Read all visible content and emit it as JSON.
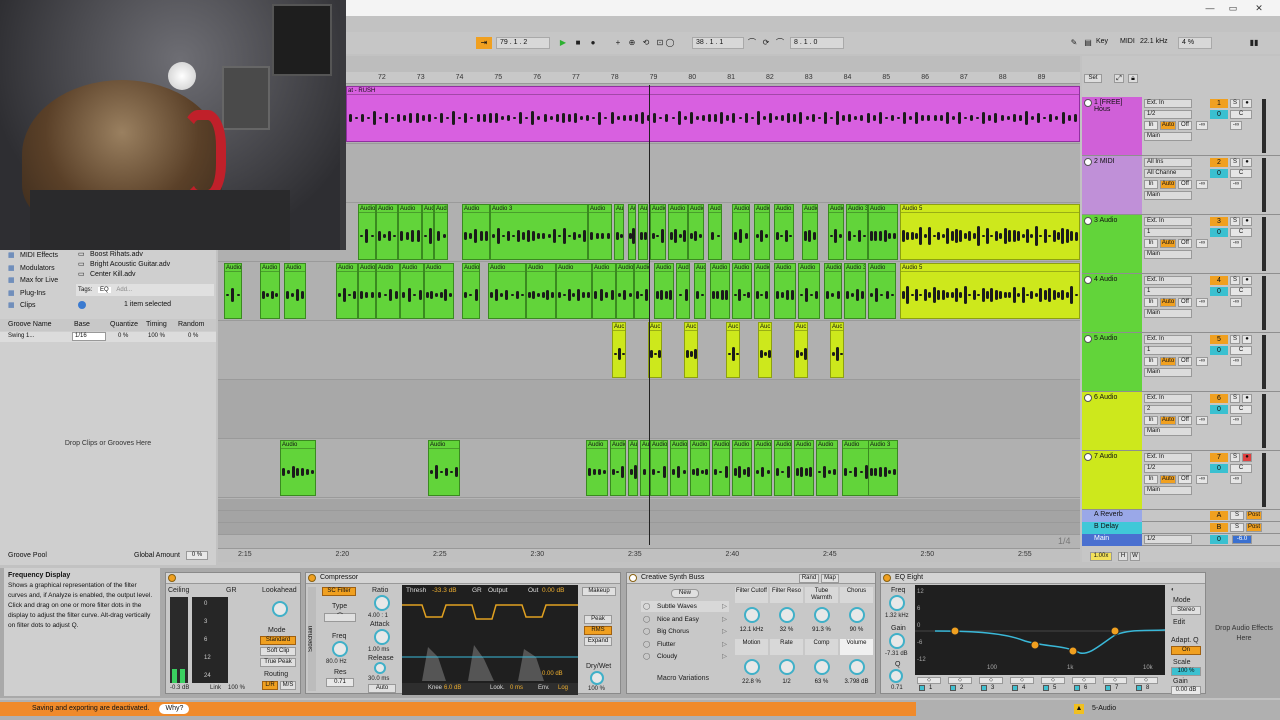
{
  "titlebar": {
    "min": "—",
    "max": "▭",
    "close": "✕"
  },
  "transport": {
    "position": "79 .  1 .  2",
    "loop_start": "38 .  1 .  1",
    "loop_length": "8 .  1 .  0",
    "key_label": "Key",
    "midi_label": "MIDI",
    "sample_rate": "22.1 kHz",
    "cpu": "4 %"
  },
  "ruler": {
    "bars": [
      "72",
      "73",
      "74",
      "75",
      "76",
      "77",
      "78",
      "79",
      "80",
      "81",
      "82",
      "83",
      "84",
      "85",
      "86",
      "87",
      "88",
      "89"
    ],
    "set_label": "Set"
  },
  "time_ruler": [
    "2:15",
    "2:20",
    "2:25",
    "2:30",
    "2:35",
    "2:40",
    "2:45",
    "2:50",
    "2:55"
  ],
  "zoom_label": "1/4",
  "browser": {
    "items": [
      "MIDI Effects",
      "Modulators",
      "Max for Live",
      "Plug-Ins",
      "Clips"
    ],
    "files": [
      "Boost Rihats.adv",
      "Bright Acoustic Guitar.adv",
      "Center Kill.adv"
    ],
    "tags_label": "Tags:",
    "tags_value": "EQ",
    "tags_add": "Add...",
    "selection": "1 item selected"
  },
  "groove": {
    "headers": [
      "Groove Name",
      "Base",
      "Quantize",
      "Timing",
      "Random"
    ],
    "row": {
      "name": "Swing 1...",
      "base": "1/16",
      "quantize": "0 %",
      "timing": "100 %",
      "random": "0 %"
    },
    "drop_text": "Drop Clips or Grooves Here",
    "pool_label": "Groove Pool",
    "global_label": "Global Amount",
    "global_value": "0 %"
  },
  "clips": {
    "track1": "at - RUSH",
    "audio": "Audio",
    "audio3": "Audio 3",
    "audio5": "Audio 5",
    "aud": "Auc"
  },
  "tracks": [
    {
      "name": "1 [FREE] Hous",
      "num": "1",
      "input": "Ext. In",
      "channel": "1/2",
      "out": "Main",
      "vol": "0",
      "pan": "C"
    },
    {
      "name": "2 MIDI",
      "num": "2",
      "input": "All Ins",
      "channel": "All Channe",
      "out": "Main",
      "vol": "0",
      "pan": "C"
    },
    {
      "name": "3 Audio",
      "num": "3",
      "input": "Ext. In",
      "channel": "1",
      "out": "Main",
      "vol": "0",
      "pan": "C"
    },
    {
      "name": "4 Audio",
      "num": "4",
      "input": "Ext. In",
      "channel": "1",
      "out": "Main",
      "vol": "0",
      "pan": "C"
    },
    {
      "name": "5 Audio",
      "num": "5",
      "input": "Ext. In",
      "channel": "1",
      "out": "Main",
      "vol": "0",
      "pan": "C"
    },
    {
      "name": "6 Audio",
      "num": "6",
      "input": "Ext. In",
      "channel": "2",
      "out": "Main",
      "vol": "0",
      "pan": "C"
    },
    {
      "name": "7 Audio",
      "num": "7",
      "input": "Ext. In",
      "channel": "1/2",
      "out": "Main",
      "vol": "0",
      "pan": "C"
    }
  ],
  "monitor": {
    "in": "In",
    "auto": "Auto",
    "off": "Off",
    "inf": "-∞"
  },
  "returns": [
    {
      "name": "A Reverb",
      "letter": "A",
      "post": "Post"
    },
    {
      "name": "B Delay",
      "letter": "B",
      "post": "Post"
    }
  ],
  "main": {
    "name": "Main",
    "channel": "1/2",
    "vol": "0",
    "meter": "-6.0"
  },
  "mixer_footer": {
    "zoom": "1.00x",
    "h": "H",
    "w": "W"
  },
  "info": {
    "title": "Frequency Display",
    "text": "Shows a graphical representation of the filter curves and, if Analyze is enabled, the output level. Click and drag on one or more filter dots in the display to adjust the filter curve. Alt-drag vertically on filter dots to adjust Q."
  },
  "limiter": {
    "ceiling": "Ceiling",
    "gr": "GR",
    "lookahead": "Lookahead",
    "mode": "Mode",
    "standard": "Standard",
    "soft_clip": "Soft Clip",
    "true_peak": "True Peak",
    "routing": "Routing",
    "lr": "L/R",
    "ms": "M/S",
    "ceiling_val": "-0.3 dB",
    "link_label": "Link",
    "link_val": "100 %",
    "scale": [
      "0",
      "3",
      "6",
      "12",
      "24"
    ]
  },
  "compressor": {
    "title": "Compressor",
    "sc_filter": "SC Filter",
    "type": "Type",
    "freq": "Freq",
    "freq_val": "80.0 Hz",
    "res": "Res",
    "res_val": "0.71",
    "sidechain": "Sidechain",
    "ratio": "Ratio",
    "ratio_val": "4.00 : 1",
    "attack": "Attack",
    "attack_val": "1.00 ms",
    "release": "Release",
    "release_val": "30.0 ms",
    "auto": "Auto",
    "thresh": "Thresh",
    "thresh_val": "-33.3 dB",
    "gr": "GR",
    "output": "Output",
    "out": "Out",
    "out_val": "0.00 dB",
    "knee": "Knee",
    "knee_val": "6.0 dB",
    "look": "Look.",
    "look_val": "0 ms",
    "env": "Env.",
    "log": "Log",
    "makeup": "Makeup",
    "peak": "Peak",
    "rms": "RMS",
    "expand": "Expand",
    "drywet": "Dry/Wet",
    "drywet_val": "100 %",
    "meter_val": "0.00 dB"
  },
  "synthbuss": {
    "title": "Creative Synth Buss",
    "rand": "Rand",
    "map": "Map",
    "new": "New",
    "variations": [
      "Subtle Waves",
      "Nice and Easy",
      "Big Chorus",
      "Flutter",
      "Cloudy"
    ],
    "macro_label": "Macro Variations",
    "macros": [
      {
        "name": "Filter Cutoff",
        "value": "12.1 kHz"
      },
      {
        "name": "Filter Reso",
        "value": "32 %"
      },
      {
        "name": "Tube Warmth",
        "value": "91.3 %"
      },
      {
        "name": "Chorus",
        "value": "90 %"
      },
      {
        "name": "Motion",
        "value": "22.8 %"
      },
      {
        "name": "Rate",
        "value": "1/2"
      },
      {
        "name": "Comp",
        "value": "63 %"
      },
      {
        "name": "Volume",
        "value": "3.798 dB"
      }
    ]
  },
  "eq": {
    "title": "EQ Eight",
    "freq": "Freq",
    "freq_val": "1.32 kHz",
    "gain": "Gain",
    "gain_val": "-7.31 dB",
    "q": "Q",
    "q_val": "0.71",
    "db_scale": [
      "12",
      "6",
      "0",
      "-6",
      "-12"
    ],
    "hz_scale": [
      "100",
      "1k",
      "10k"
    ],
    "mode": "Mode",
    "mode_val": "Stereo",
    "edit": "Edit",
    "adapt_q": "Adapt. Q",
    "on": "On",
    "scale": "Scale",
    "scale_val": "100 %",
    "out_gain": "Gain",
    "out_gain_val": "0.00 dB",
    "bands": [
      "1",
      "2",
      "3",
      "4",
      "5",
      "6",
      "7",
      "8"
    ]
  },
  "drop_effects": "Drop Audio Effects Here",
  "status": {
    "message": "Saving and exporting are deactivated.",
    "why": "Why?",
    "track": "5-Audio"
  }
}
